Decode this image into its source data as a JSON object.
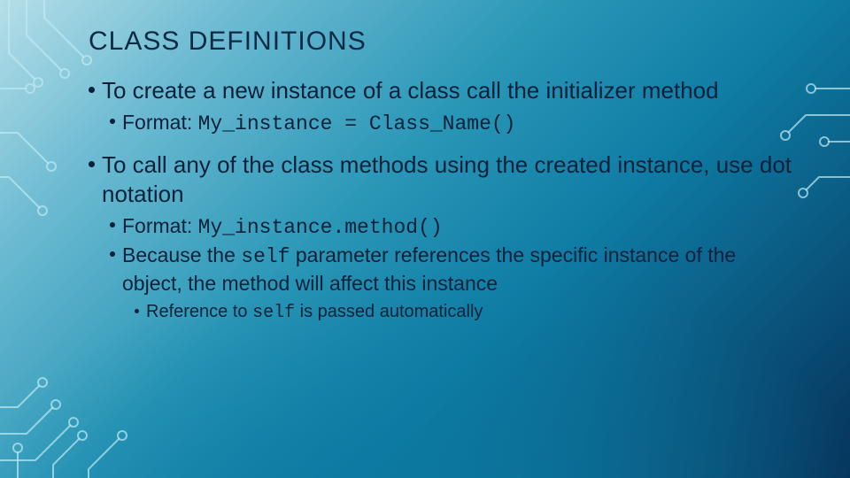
{
  "title": "CLASS DEFINITIONS",
  "b1": {
    "text": "To create a new instance of a class call the initializer method",
    "sub": {
      "label": "Format: ",
      "code": "My_instance = Class_Name()"
    }
  },
  "b2": {
    "text": "To call any of the class methods using the created instance, use dot notation",
    "sub1": {
      "label": "Format: ",
      "code": "My_instance.method()"
    },
    "sub2": {
      "pre": "Because the ",
      "code": "self",
      "post": " parameter references the specific instance of the object, the method will affect this instance"
    },
    "sub2a": {
      "pre": "Reference to ",
      "code": "self",
      "post": " is passed automatically"
    }
  }
}
